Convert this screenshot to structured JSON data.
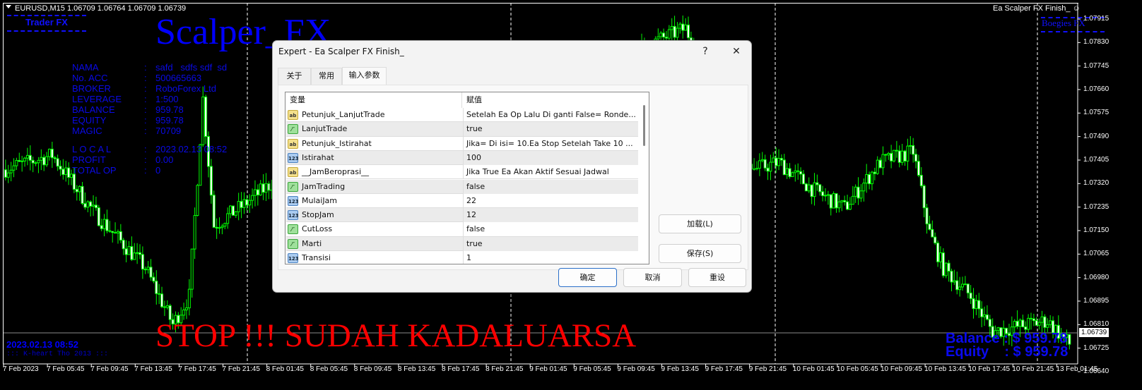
{
  "chart": {
    "symbol_header": "EURUSD,M15  1.06709 1.06764 1.06709 1.06739",
    "ea_name": "Ea Scalper FX Finish_",
    "current_price": "1.06739",
    "price_labels": [
      "1.07915",
      "1.07830",
      "1.07745",
      "1.07660",
      "1.07575",
      "1.07490",
      "1.07405",
      "1.07320",
      "1.07235",
      "1.07150",
      "1.07065",
      "1.06980",
      "1.06895",
      "1.06810",
      "1.06725",
      "1.06640"
    ],
    "time_labels": [
      "7 Feb 2023",
      "7 Feb 05:45",
      "7 Feb 09:45",
      "7 Feb 13:45",
      "7 Feb 17:45",
      "7 Feb 21:45",
      "8 Feb 01:45",
      "8 Feb 05:45",
      "8 Feb 09:45",
      "8 Feb 13:45",
      "8 Feb 17:45",
      "8 Feb 21:45",
      "9 Feb 01:45",
      "9 Feb 05:45",
      "9 Feb 09:45",
      "9 Feb 13:45",
      "9 Feb 17:45",
      "9 Feb 21:45",
      "10 Feb 01:45",
      "10 Feb 05:45",
      "10 Feb 09:45",
      "10 Feb 13:45",
      "10 Feb 17:45",
      "10 Feb 21:45",
      "13 Feb 01:45"
    ],
    "price_keypoints": [
      [
        0,
        1.0737
      ],
      [
        18,
        1.07423
      ],
      [
        33,
        1.07219
      ],
      [
        52,
        1.07015
      ],
      [
        62,
        1.06811
      ],
      [
        68,
        1.06913
      ],
      [
        73,
        1.07627
      ],
      [
        77,
        1.07168
      ],
      [
        88,
        1.07244
      ],
      [
        98,
        1.07321
      ],
      [
        155,
        1.0747
      ],
      [
        249,
        1.07882
      ],
      [
        258,
        1.0768
      ],
      [
        274,
        1.07372
      ],
      [
        283,
        1.07397
      ],
      [
        296,
        1.07295
      ],
      [
        307,
        1.07232
      ],
      [
        320,
        1.07397
      ],
      [
        332,
        1.07436
      ],
      [
        338,
        1.07142
      ],
      [
        343,
        1.07015
      ],
      [
        353,
        1.06913
      ],
      [
        361,
        1.06785
      ],
      [
        374,
        1.06811
      ],
      [
        381,
        1.06824
      ],
      [
        389,
        1.06739
      ]
    ],
    "colors": {
      "bg": "#000000",
      "candle": "#00ff00",
      "text_blue": "#0000ff",
      "stop_red": "#ff0000"
    }
  },
  "overlay": {
    "trader_fx": "Trader FX",
    "boegies_fx": "Boegies FX",
    "title": "Scalper_FX",
    "info": [
      {
        "label": "NAMA",
        "sep": ":",
        "value": "safd   sdfs sdf  sd"
      },
      {
        "label": "No. ACC",
        "sep": ":",
        "value": "500665663"
      },
      {
        "label": "BROKER",
        "sep": ":",
        "value": "RoboForex Ltd"
      },
      {
        "label": "LEVERAGE",
        "sep": ":",
        "value": "1:500"
      },
      {
        "label": "BALANCE",
        "sep": ":",
        "value": "959.78"
      },
      {
        "label": "EQUITY",
        "sep": ":",
        "value": "959.78"
      },
      {
        "label": "MAGIC",
        "sep": ":",
        "value": "70709"
      }
    ],
    "info2": [
      {
        "label": "L O C A L",
        "sep": ":",
        "value": "2023.02.13 08:52"
      },
      {
        "label": "PROFIT",
        "sep": ":",
        "value": "0.00"
      },
      {
        "label": "TOTAL OP",
        "sep": ":",
        "value": "0"
      }
    ],
    "stop_text": "STOP !!! SUDAH KADALUARSA",
    "datetime": "2023.02.13 08:52",
    "credit": "::: K-heart Tho 2013 :::",
    "balance": "Balance : $ 959.78",
    "equity": "Equity    : $ 959.78"
  },
  "dialog": {
    "title": "Expert - Ea Scalper FX Finish_",
    "help": "?",
    "close": "✕",
    "tabs": [
      "关于",
      "常用",
      "输入参数"
    ],
    "columns": [
      "变量",
      "赋值"
    ],
    "rows": [
      {
        "type": "ab",
        "name": "Petunjuk_LanjutTrade",
        "value": "Setelah Ea Op Lalu Di ganti False= Ronde..."
      },
      {
        "type": "bool",
        "name": "LanjutTrade",
        "value": "true"
      },
      {
        "type": "ab",
        "name": "Petunjuk_Istirahat",
        "value": "Jika= Di isi= 10.Ea Stop Setelah Take 10 ..."
      },
      {
        "type": "num",
        "name": "Istirahat",
        "value": "100"
      },
      {
        "type": "ab",
        "name": "__JamBeroprasi__",
        "value": "Jika True Ea Akan Aktif Sesuai Jadwal"
      },
      {
        "type": "bool",
        "name": "JamTrading",
        "value": "false"
      },
      {
        "type": "num",
        "name": "MulaiJam",
        "value": "22"
      },
      {
        "type": "num",
        "name": "StopJam",
        "value": "12"
      },
      {
        "type": "bool",
        "name": "CutLoss",
        "value": "false"
      },
      {
        "type": "bool",
        "name": "Marti",
        "value": "true"
      },
      {
        "type": "num",
        "name": "Transisi",
        "value": "1"
      }
    ],
    "load": "加载(L)",
    "save": "保存(S)",
    "ok": "确定",
    "cancel": "取消",
    "reset": "重设"
  }
}
